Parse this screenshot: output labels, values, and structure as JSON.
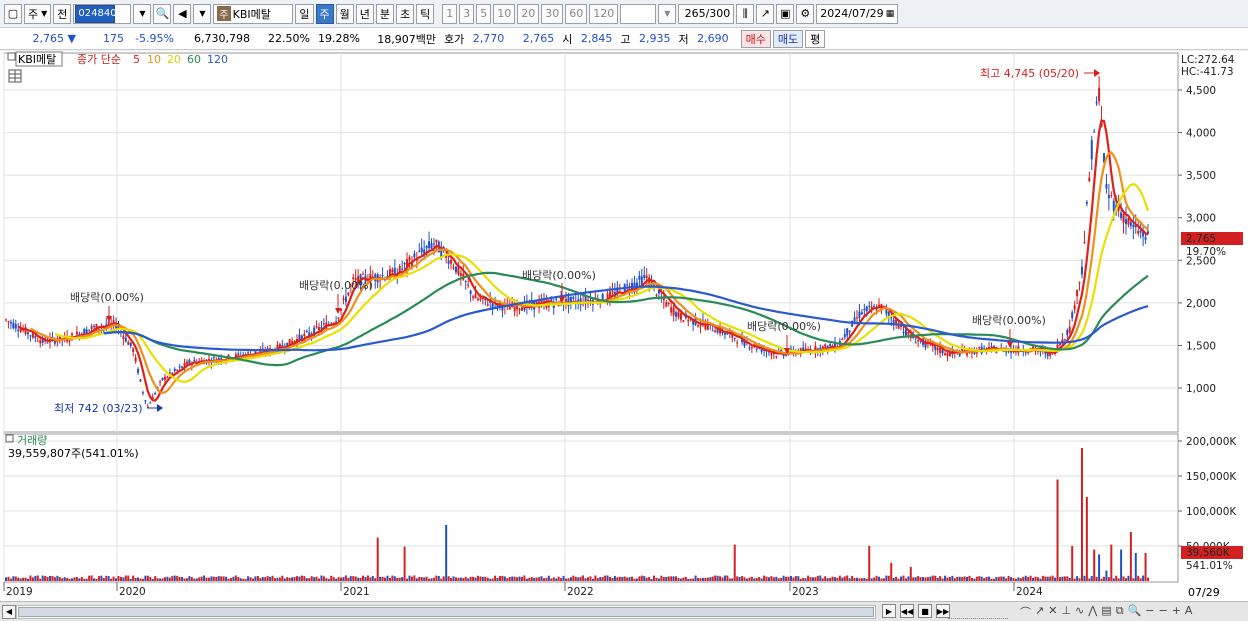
{
  "toolbar": {
    "type_label": "주",
    "prev_label": "전",
    "code": "024840",
    "name": "KBI메탈",
    "name_prefix": "주",
    "periods": [
      "일",
      "주",
      "월",
      "년",
      "분",
      "초",
      "틱"
    ],
    "active_period": "주",
    "numbers": [
      "1",
      "3",
      "5",
      "10",
      "20",
      "30",
      "60",
      "120"
    ],
    "count": "265",
    "count_total": "/300",
    "date": "2024/07/29"
  },
  "quote": {
    "price": "2,765",
    "change": "175",
    "change_pct": "-5.95%",
    "volume": "6,730,798",
    "vol_ratio": "22.50%",
    "turnover": "19.28%",
    "amount": "18,907백만",
    "hoga_label": "호가",
    "ask": "2,770",
    "bid": "2,765",
    "open_label": "시",
    "open": "2,845",
    "high_label": "고",
    "high": "2,935",
    "low_label": "저",
    "low": "2,690",
    "buy": "매수",
    "sell": "매도",
    "avg": "평"
  },
  "legend": {
    "name": "KBI메탈",
    "ma_label": "종가 단순",
    "ma": [
      {
        "p": "5",
        "color": "#e0201a"
      },
      {
        "p": "10",
        "color": "#f09018"
      },
      {
        "p": "20",
        "color": "#e8e000"
      },
      {
        "p": "60",
        "color": "#2a8a58"
      },
      {
        "p": "120",
        "color": "#2a5ad0"
      }
    ]
  },
  "right_top": {
    "lc": "LC:272.64",
    "hc": "HC:-41.73"
  },
  "price_axis": [
    "4,500",
    "4,000",
    "3,500",
    "3,000",
    "2,500",
    "2,000",
    "1,500",
    "1,000"
  ],
  "current_price": {
    "value": "2,765",
    "pct": "19.70%"
  },
  "annotations": {
    "high": "최고 4,745 (05/20)",
    "low": "최저 742 (03/23)",
    "div1": "배당락(0.00%)",
    "div2": "배당락(0.00%)",
    "div3": "배당락(0.00%)",
    "div4": "배당락(0.00%)",
    "div5": "배당락(0.00%)"
  },
  "volume": {
    "title": "거래량",
    "value": "39,559,807주(541.01%)",
    "axis": [
      "200,000K",
      "150,000K",
      "100,000K",
      "50,000K"
    ],
    "current": "39,560K",
    "current_pct": "541.01%"
  },
  "x_axis": [
    "2019",
    "2020",
    "2021",
    "2022",
    "2023",
    "2024"
  ],
  "x_last": "07/29",
  "colors": {
    "up": "#d42020",
    "down": "#2050c8",
    "accent": "#3a78c8"
  }
}
